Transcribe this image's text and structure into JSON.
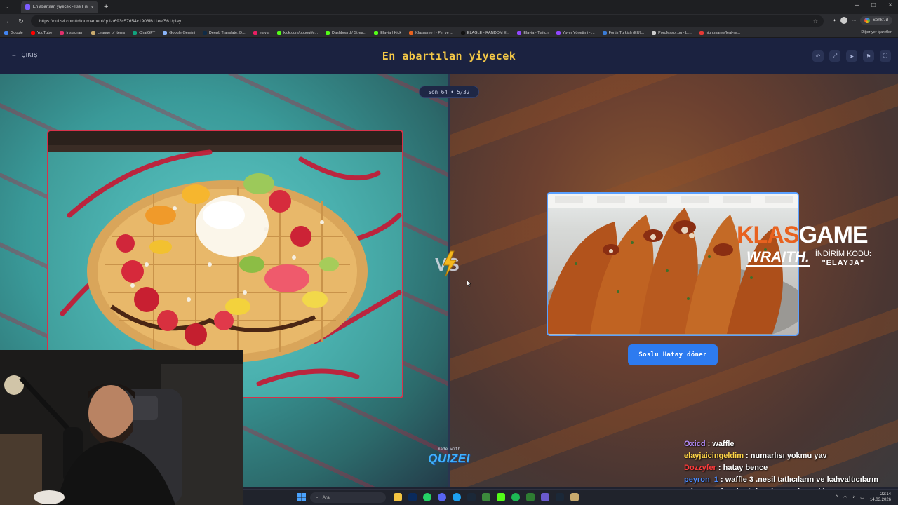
{
  "browser": {
    "tab_title": "En abartılan yiyecek - lise Fist, Kiz",
    "url": "https://quizei.com/tr/tournament/quiz/693c57d54c1908f611eef561/play",
    "profile_label": "Senkr. d",
    "bookmarks": [
      {
        "label": "Google",
        "color": "#4285f4"
      },
      {
        "label": "YouTube",
        "color": "#ff0000"
      },
      {
        "label": "Instagram",
        "color": "#e1306c"
      },
      {
        "label": "League of Items",
        "color": "#c8aa6e"
      },
      {
        "label": "ChatGPT",
        "color": "#10a37f"
      },
      {
        "label": "Google Gemini",
        "color": "#8ab4f8"
      },
      {
        "label": "DeepL Translate: D...",
        "color": "#0f2b46"
      },
      {
        "label": "elayja",
        "color": "#e91e63"
      },
      {
        "label": "kick.com/popout/e...",
        "color": "#53fc18"
      },
      {
        "label": "Dashboard / Strea...",
        "color": "#53fc18"
      },
      {
        "label": "Elayja | Kick",
        "color": "#53fc18"
      },
      {
        "label": "Klasgame | - Pin ve ...",
        "color": "#e8621f"
      },
      {
        "label": "ELAGLE - RANDOM E...",
        "color": "#111111"
      },
      {
        "label": "Elayja - Twitch",
        "color": "#9146ff"
      },
      {
        "label": "Yayın Yönetimi - ...",
        "color": "#9146ff"
      },
      {
        "label": "Fortis Turkish (EU)...",
        "color": "#3a7bd5"
      },
      {
        "label": "Porofessor.gg - Li...",
        "color": "#cccccc"
      },
      {
        "label": "nightmaree/leaf-re...",
        "color": "#e53935"
      }
    ],
    "bookmarks_folder": "Diğer yer işaretleri"
  },
  "header": {
    "exit_label": "ÇIKIŞ",
    "title": "En abartılan yiyecek",
    "icons": [
      "undo-icon",
      "share-icon",
      "send-icon",
      "flag-icon",
      "fullscreen-icon"
    ]
  },
  "round": {
    "label": "Son 64 • 5/32"
  },
  "choices": {
    "left": {
      "image": "waffle-with-fruit-and-ice-cream"
    },
    "right": {
      "image": "soslu-hatay-doner-wraps",
      "label": "Soslu Hatay döner"
    }
  },
  "footer": {
    "made_with": "made with",
    "logo": "QUIZEI"
  },
  "sponsor": {
    "brand_a": "KLAS",
    "brand_b": "GAME",
    "wraith": "WRAITH.",
    "code_label": "İNDİRİM KODU:",
    "code": "\"ELAYJA\""
  },
  "chat": [
    {
      "user": "Oxicd",
      "color": "#b48cff",
      "message": " : waffle"
    },
    {
      "user": "elayjaicingeldim",
      "color": "#ffd447",
      "message": " : numarlısı yokmu yav"
    },
    {
      "user": "Dozzyfer",
      "color": "#ff3b3b",
      "message": " : hatay bence"
    },
    {
      "user": "peyron_1",
      "color": "#4a8cff",
      "message": " : waffle 3 .nesil tatlıcıların ve kahvaltıcıların"
    },
    {
      "user": "",
      "color": "#ffffff",
      "message": "ydurmasıdır. abartıdır. elenmesi gerekir"
    }
  ],
  "taskbar": {
    "search_label": "Ara",
    "time": "22:14",
    "date": "14.03.2026"
  },
  "colors": {
    "accent_title": "#f3c747",
    "left_border": "#d8324a",
    "right_border": "#5aa0ff",
    "choice_button": "#2d7bf0"
  }
}
